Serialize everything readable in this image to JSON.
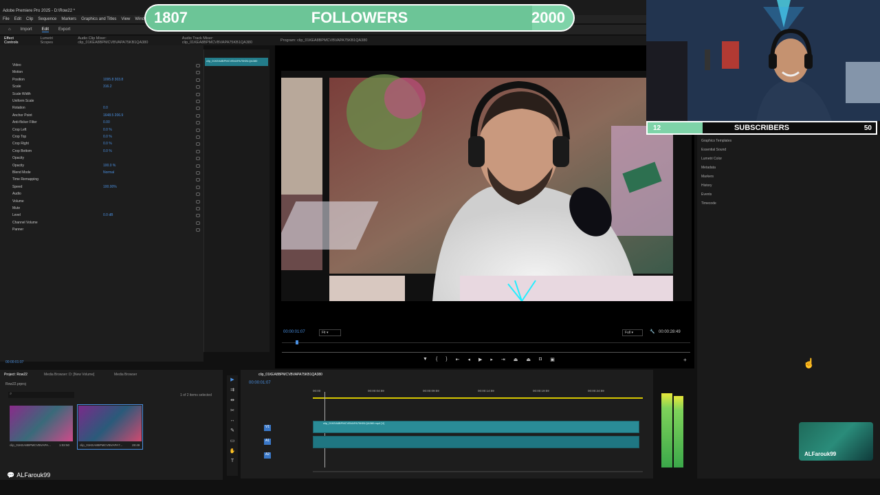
{
  "app": {
    "title": "Adobe Premiere Pro 2025 - D:\\Row22 *"
  },
  "menu": [
    "File",
    "Edit",
    "Clip",
    "Sequence",
    "Markers",
    "Graphics and Titles",
    "View",
    "Window"
  ],
  "workspace_tabs": [
    "Import",
    "Edit",
    "Export"
  ],
  "overlay": {
    "followers": {
      "current": "1807",
      "label": "FOLLOWERS",
      "goal": "2000",
      "progress": 0.9035
    },
    "subscribers": {
      "current": "12",
      "label": "SUBSCRIBERS",
      "goal": "50",
      "progress": 0.24
    }
  },
  "panels": {
    "source_tabs": [
      "Effect Controls",
      "Lumetri Scopes",
      "Audio Clip Mixer: clip_01KEA8BPMCVBVAPA75KB1QA380",
      "Audio Track Mixer: clip_01KEA8BPMCVBVAPA75KB1QA380"
    ],
    "program_title": "Program: clip_01KEA8BPMCVBVAPA75KB1QA380",
    "effect_rows": [
      {
        "label": "Video",
        "value": ""
      },
      {
        "label": "Motion",
        "value": ""
      },
      {
        "label": "Position",
        "value": "1095.8    303.8"
      },
      {
        "label": "Scale",
        "value": "316.2"
      },
      {
        "label": "Scale Width",
        "value": ""
      },
      {
        "label": "Uniform Scale",
        "value": ""
      },
      {
        "label": "Rotation",
        "value": "0.0"
      },
      {
        "label": "Anchor Point",
        "value": "1648.5    206.9"
      },
      {
        "label": "Anti-flicker Filter",
        "value": "0.00"
      },
      {
        "label": "Crop Left",
        "value": "0.0 %"
      },
      {
        "label": "Crop Top",
        "value": "0.0 %"
      },
      {
        "label": "Crop Right",
        "value": "0.0 %"
      },
      {
        "label": "Crop Bottom",
        "value": "0.0 %"
      },
      {
        "label": "Opacity",
        "value": ""
      },
      {
        "label": "Opacity",
        "value": "100.0 %"
      },
      {
        "label": "Blend Mode",
        "value": "Normal"
      },
      {
        "label": "Time Remapping",
        "value": ""
      },
      {
        "label": "Speed",
        "value": "100.00%"
      },
      {
        "label": "Audio",
        "value": ""
      },
      {
        "label": "Volume",
        "value": ""
      },
      {
        "label": "Mute",
        "value": ""
      },
      {
        "label": "Level",
        "value": "0.0 dB"
      },
      {
        "label": "Channel Volume",
        "value": ""
      },
      {
        "label": "Panner",
        "value": ""
      }
    ],
    "ec_time": "00:00:01:07",
    "program_timecode": "00:00:01:07",
    "program_fit": "Fit",
    "program_full": "Full",
    "program_duration": "00:00:28:49",
    "right_items": [
      "Graphics Templates",
      "Essential Sound",
      "Lumetri Color",
      "Metadata",
      "Markers",
      "History",
      "Events",
      "Timecode"
    ],
    "project_title": "Project: Row22",
    "project_tabs": [
      "Media Browser: D: [New Volume]",
      "Media Browser"
    ],
    "project_file": "Row22.prproj",
    "project_count": "1 of 2 items selected",
    "clips": [
      {
        "name": "clip_01KEA8BPMCVBVAPA...",
        "duration": "1:02:50"
      },
      {
        "name": "clip_01KEA8BPMCVBVAPA7...",
        "duration": "28:49"
      }
    ],
    "timeline_title": "clip_01KEA8BPMCVBVAPA75KB1QA380",
    "timeline_time": "00:00:01:07",
    "ruler": [
      "00:00",
      "00:00:04:59",
      "00:00:09:59",
      "00:00:14:59",
      "00:00:19:59",
      "00:00:24:59"
    ],
    "video_clip": "clip_01KEA8BPMCVBVAPA75KB1QA380.mp4 [V]",
    "tracks": [
      "V1",
      "A1",
      "A2"
    ]
  },
  "chat": {
    "user": "ALFarouk99"
  },
  "facecam_label": "ALFarouk99",
  "colors": {
    "accent": "#7ed3a8",
    "clip": "#2a8c97",
    "blue": "#4a90e2"
  }
}
